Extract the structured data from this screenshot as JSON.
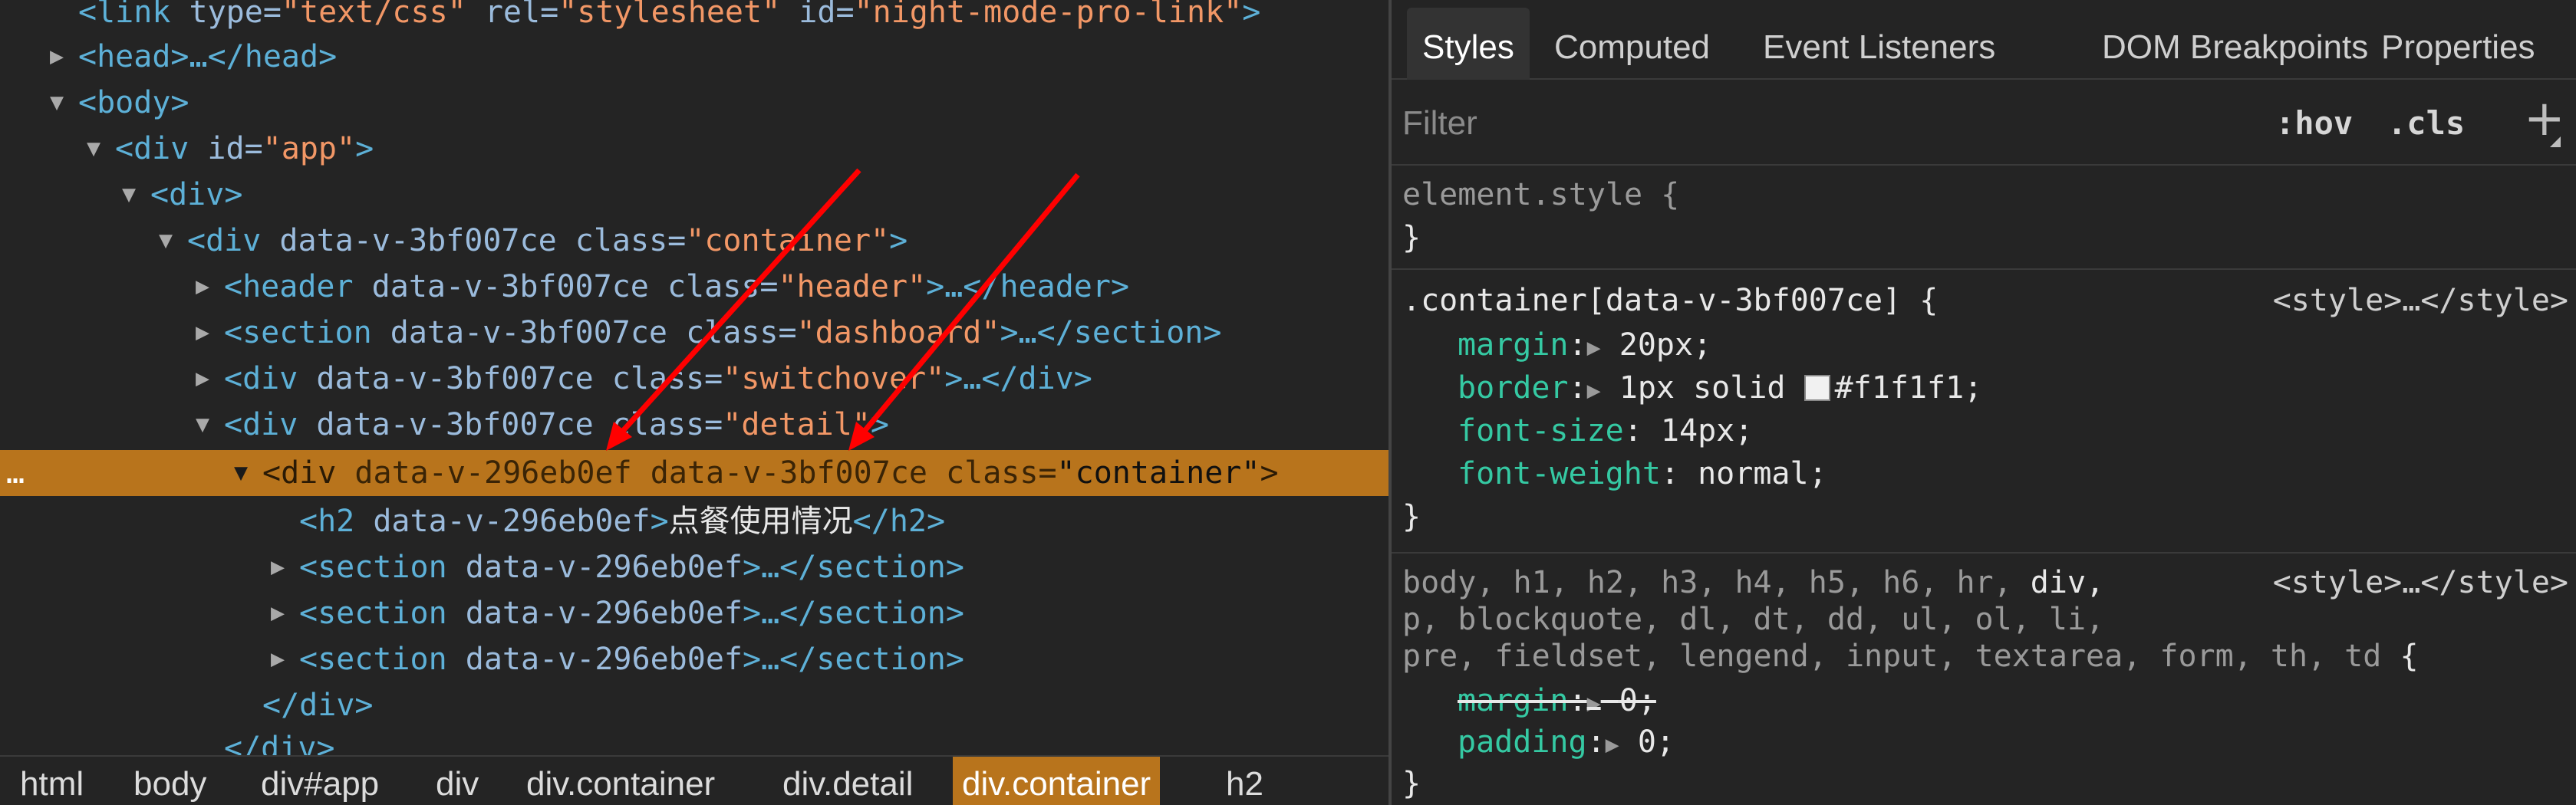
{
  "elements": {
    "lines": [
      {
        "tag_open": "<link ",
        "attrs": [
          {
            "n": "type",
            "v": "\"text/css\""
          },
          {
            "n": "rel",
            "v": "\"stylesheet\""
          },
          {
            "n": "id",
            "v": "\"night-mode-pro-link\""
          }
        ],
        "tag_close": ">"
      },
      {
        "text": "<head>…</head>"
      },
      {
        "text": "<body>"
      },
      {
        "tag_open": "<div ",
        "attr_name": "id=",
        "attr_value": "\"app\"",
        "tag_close": ">"
      },
      {
        "text": "<div>"
      },
      {
        "tag_open": "<div ",
        "attr_plain": "data-v-3bf007ce class=",
        "attr_value": "\"container\"",
        "tag_close": ">"
      },
      {
        "tag_open": "<header ",
        "attr_plain": "data-v-3bf007ce class=",
        "attr_value": "\"header\"",
        "tag_close": ">…</header>"
      },
      {
        "tag_open": "<section ",
        "attr_plain": "data-v-3bf007ce class=",
        "attr_value": "\"dashboard\"",
        "tag_close": ">…</section>"
      },
      {
        "tag_open": "<div ",
        "attr_plain": "data-v-3bf007ce class=",
        "attr_value": "\"switchover\"",
        "tag_close": ">…</div>"
      },
      {
        "tag_open": "<div ",
        "attr_plain": "data-v-3bf007ce class=",
        "attr_value": "\"detail\"",
        "tag_close": ">"
      },
      {
        "tag_open": "<div ",
        "attr_plain": "data-v-296eb0ef data-v-3bf007ce class=",
        "attr_value": "\"container\"",
        "tag_close": ">"
      },
      {
        "tag_open": "<h2 ",
        "attr_plain": "data-v-296eb0ef",
        "gt": ">",
        "inner": "点餐使用情况",
        "tag_close": "</h2>"
      },
      {
        "tag_open": "<section ",
        "attr_plain": "data-v-296eb0ef",
        "tag_close": ">…</section>"
      },
      {
        "tag_open": "<section ",
        "attr_plain": "data-v-296eb0ef",
        "tag_close": ">…</section>"
      },
      {
        "tag_open": "<section ",
        "attr_plain": "data-v-296eb0ef",
        "tag_close": ">…</section>"
      },
      {
        "text": "</div>"
      },
      {
        "text": "</div>"
      }
    ],
    "selected_marker": "…",
    "breadcrumbs": [
      "html",
      "body",
      "div#app",
      "div",
      "div.container",
      "div.detail",
      "div.container",
      "h2"
    ]
  },
  "styles": {
    "tabs": [
      "Styles",
      "Computed",
      "Event Listeners",
      "DOM Breakpoints",
      "Properties"
    ],
    "filter_placeholder": "Filter",
    "hov_label": ":hov",
    "cls_label": ".cls",
    "plus_label": "+",
    "rules": [
      {
        "selector": "element.style {",
        "close": "}"
      },
      {
        "selector": ".container[data-v-3bf007ce] {",
        "source": "<style>…</style>",
        "props": [
          {
            "name": "margin",
            "value": "20px;"
          },
          {
            "name": "border",
            "value": "1px solid ",
            "swatch_value": "#f1f1f1;"
          },
          {
            "name": "font-size",
            "value": "14px;"
          },
          {
            "name": "font-weight",
            "value": "normal;"
          }
        ],
        "close": "}"
      },
      {
        "selector_grey_1": "body, h1, h2, h3, h4, h5, h6, hr, ",
        "selector_hl": "div,",
        "selector_grey_2": "p, blockquote, dl, dt, dd, ul, ol, li,",
        "selector_grey_3": "pre, fieldset, lengend, input, textarea, form, th, td ",
        "brace": "{",
        "source": "<style>…</style>",
        "props": [
          {
            "name": "margin",
            "value": "0;",
            "struck": true
          },
          {
            "name": "padding",
            "value": "0;"
          }
        ],
        "close": "}"
      }
    ],
    "colors": {
      "swatch": "#f1f1f1",
      "selection": "#b8741c",
      "property": "#35c9a3",
      "arrow": "#ff0000"
    }
  }
}
